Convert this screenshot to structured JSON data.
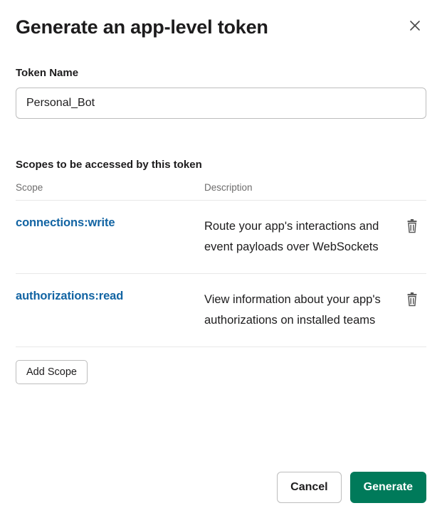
{
  "dialog": {
    "title": "Generate an app-level token",
    "token_name_label": "Token Name",
    "token_name_value": "Personal_Bot",
    "scopes_section_label": "Scopes to be accessed by this token",
    "table": {
      "headers": {
        "scope": "Scope",
        "description": "Description"
      },
      "rows": [
        {
          "scope": "connections:write",
          "description": "Route your app's interactions and event payloads over WebSockets"
        },
        {
          "scope": "authorizations:read",
          "description": "View information about your app's authorizations on installed teams"
        }
      ]
    },
    "add_scope_label": "Add Scope",
    "cancel_label": "Cancel",
    "generate_label": "Generate"
  }
}
